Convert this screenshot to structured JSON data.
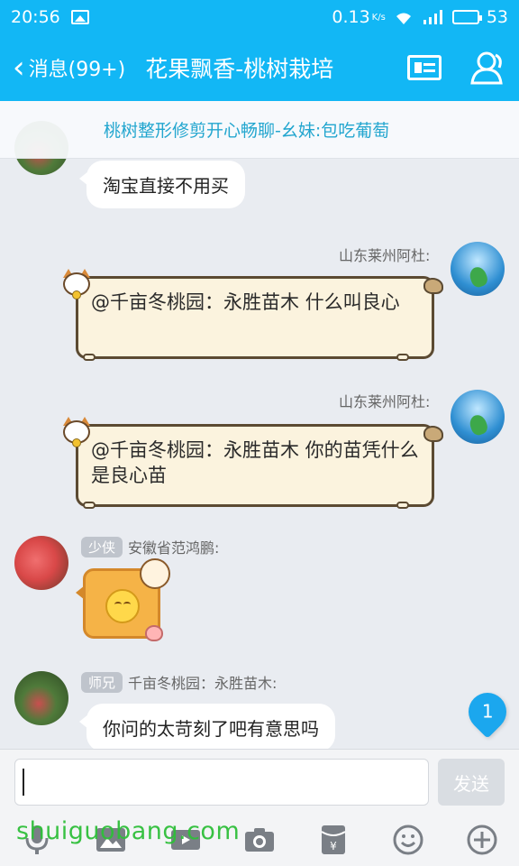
{
  "status_bar": {
    "time": "20:56",
    "net_speed": "0.13",
    "net_unit": "K/s",
    "battery_percent": "53",
    "battery_level": 0.53
  },
  "header": {
    "back_label": "消息(99+)",
    "title": "花果飘香-桃树栽培"
  },
  "announcement": {
    "text": "桃树整形修剪开心畅聊-幺妹:包吃葡萄"
  },
  "messages": [
    {
      "text": "淘宝直接不用买"
    },
    {
      "sender": "山东莱州阿杜:",
      "text": "@千亩冬桃园：永胜苗木 什么叫良心"
    },
    {
      "sender": "山东莱州阿杜:",
      "text": "@千亩冬桃园：永胜苗木 你的苗凭什么是良心苗"
    },
    {
      "badge": "少侠",
      "sender": "安徽省范鸿鹏:",
      "sticker": "smile-sticker"
    },
    {
      "badge": "师兄",
      "sender": "千亩冬桃园：永胜苗木:",
      "text": "你问的太苛刻了吧有意思吗"
    }
  ],
  "unread_count": "1",
  "composer": {
    "value": "",
    "send_label": "发送"
  },
  "toolbar_icons": [
    "mic-icon",
    "image-icon",
    "video-icon",
    "camera-icon",
    "red-packet-icon",
    "emoji-icon",
    "plus-icon"
  ],
  "watermark": "shuiguobang.com",
  "colors": {
    "accent": "#12b7f5",
    "announce_text": "#23a6cf",
    "bubble_cream": "#fbf3de",
    "watermark": "#2fbf3a"
  }
}
